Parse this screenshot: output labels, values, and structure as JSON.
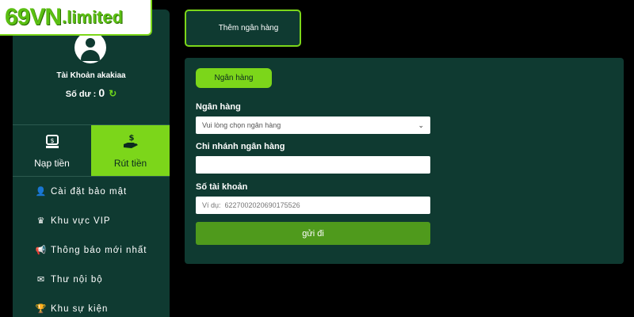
{
  "logo": {
    "main": "69VN",
    "suffix": ".limited"
  },
  "profile": {
    "account_label": "Tài Khoản akakiaa",
    "balance_label": "Số dư :",
    "balance_value": "0"
  },
  "tabs": [
    {
      "label": "Nạp tiền",
      "icon": "money-bag-icon"
    },
    {
      "label": "Rút tiền",
      "icon": "hand-dollar-icon"
    }
  ],
  "menu": [
    {
      "label": "Cài đặt bảo mật",
      "icon": "user-lock-icon"
    },
    {
      "label": "Khu vực VIP",
      "icon": "crown-icon"
    },
    {
      "label": "Thông báo mới nhất",
      "icon": "megaphone-icon"
    },
    {
      "label": "Thư nội bộ",
      "icon": "envelope-icon"
    },
    {
      "label": "Khu sự kiện",
      "icon": "trophy-icon"
    }
  ],
  "add_bank_button": "Thêm ngân hàng",
  "form": {
    "tab_label": "Ngân hàng",
    "bank_label": "Ngân hàng",
    "bank_placeholder": "Vui lòng chọn ngân hàng",
    "branch_label": "Chi nhánh ngân hàng",
    "branch_value": "",
    "account_label": "Số tài khoản",
    "account_placeholder": "Ví dụ:  6227002020690175526",
    "submit_label": "gửi đi"
  },
  "colors": {
    "accent": "#7cd61a",
    "panel": "#0f3a31",
    "submit": "#4f9a1c",
    "background": "#000000"
  }
}
